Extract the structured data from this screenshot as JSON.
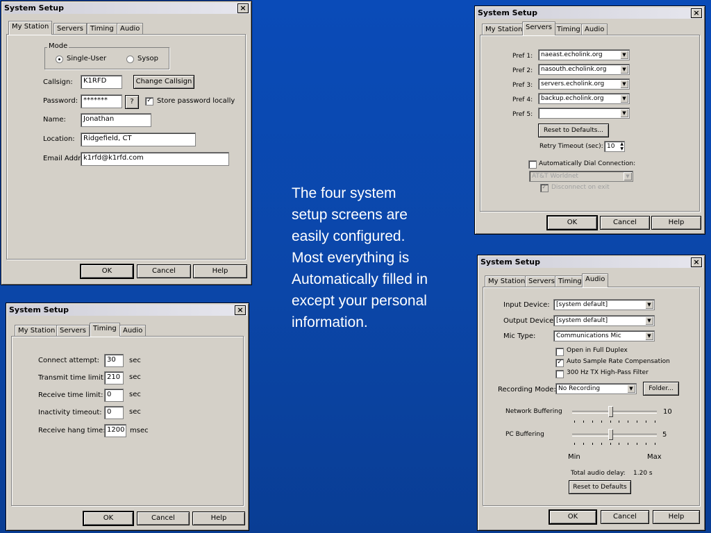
{
  "caption": "The four system setup screens are easily configured. Most everything is Automatically filled in except your personal information.",
  "dialogs": {
    "station": {
      "title": "System Setup",
      "tabs": [
        "My Station",
        "Servers",
        "Timing",
        "Audio"
      ],
      "active_tab": "My Station",
      "mode_label": "Mode",
      "radio_single": "Single-User",
      "radio_sysop": "Sysop",
      "selected_mode": "Single-User",
      "callsign_label": "Callsign:",
      "callsign_value": "K1RFD",
      "change_callsign": "Change Callsign",
      "password_label": "Password:",
      "password_value": "*******",
      "help_q": "?",
      "store_password": "Store password locally",
      "store_password_checked": true,
      "name_label": "Name:",
      "name_value": "Jonathan",
      "location_label": "Location:",
      "location_value": "Ridgefield, CT",
      "email_label": "Email Addr:",
      "email_value": "k1rfd@k1rfd.com",
      "ok": "OK",
      "cancel": "Cancel",
      "help": "Help"
    },
    "servers": {
      "title": "System Setup",
      "tabs": [
        "My Station",
        "Servers",
        "Timing",
        "Audio"
      ],
      "active_tab": "Servers",
      "pref1_label": "Pref 1:",
      "pref1": "naeast.echolink.org",
      "pref2_label": "Pref 2:",
      "pref2": "nasouth.echolink.org",
      "pref3_label": "Pref 3:",
      "pref3": "servers.echolink.org",
      "pref4_label": "Pref 4:",
      "pref4": "backup.echolink.org",
      "pref5_label": "Pref 5:",
      "pref5": "",
      "reset": "Reset to Defaults...",
      "retry_label": "Retry Timeout (sec):",
      "retry_value": "10",
      "auto_dial": "Automatically Dial Connection:",
      "auto_dial_checked": false,
      "dial_connection": "AT&T Worldnet",
      "disconnect": "Disconnect on exit",
      "disconnect_checked": true,
      "ok": "OK",
      "cancel": "Cancel",
      "help": "Help"
    },
    "timing": {
      "title": "System Setup",
      "tabs": [
        "My Station",
        "Servers",
        "Timing",
        "Audio"
      ],
      "active_tab": "Timing",
      "connect_label": "Connect attempt:",
      "connect_value": "30",
      "connect_unit": "sec",
      "transmit_label": "Transmit time limit:",
      "transmit_value": "210",
      "transmit_unit": "sec",
      "receive_label": "Receive time limit:",
      "receive_value": "0",
      "receive_unit": "sec",
      "inactivity_label": "Inactivity timeout:",
      "inactivity_value": "0",
      "inactivity_unit": "sec",
      "hang_label": "Receive hang time:",
      "hang_value": "1200",
      "hang_unit": "msec",
      "ok": "OK",
      "cancel": "Cancel",
      "help": "Help"
    },
    "audio": {
      "title": "System Setup",
      "tabs": [
        "My Station",
        "Servers",
        "Timing",
        "Audio"
      ],
      "active_tab": "Audio",
      "input_label": "Input Device:",
      "input_value": "[system default]",
      "output_label": "Output Device:",
      "output_value": "[system default]",
      "mic_label": "Mic Type:",
      "mic_value": "Communications Mic",
      "full_duplex": "Open in Full Duplex",
      "full_duplex_checked": false,
      "auto_rate": "Auto Sample Rate Compensation",
      "auto_rate_checked": true,
      "hipass": "300 Hz TX High-Pass Filter",
      "hipass_checked": false,
      "rec_label": "Recording Mode:",
      "rec_value": "No Recording",
      "folder": "Folder...",
      "net_label": "Network Buffering",
      "net_value": "10",
      "net_level": 0.45,
      "pc_label": "PC Buffering",
      "pc_value": "5",
      "pc_level": 0.45,
      "min": "Min",
      "max": "Max",
      "delay_label": "Total audio delay:",
      "delay_value": "1.20 s",
      "reset": "Reset to Defaults",
      "ok": "OK",
      "cancel": "Cancel",
      "help": "Help"
    }
  }
}
